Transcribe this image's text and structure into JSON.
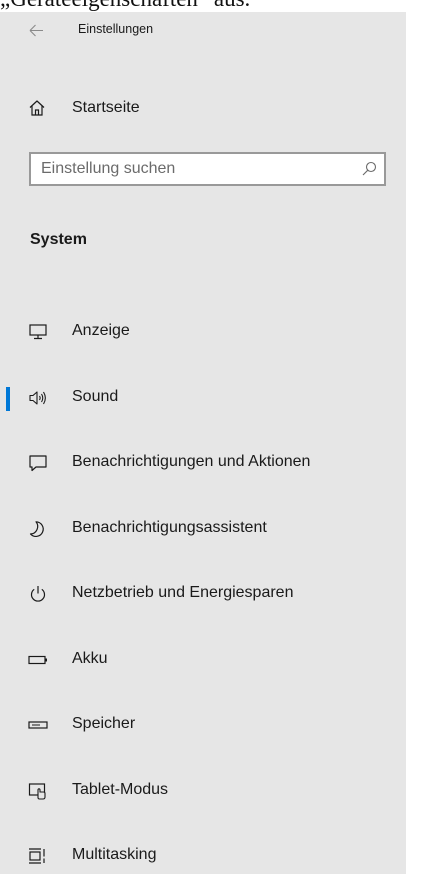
{
  "caption": {
    "partial_text": "„Geräteeigenschaften“ aus."
  },
  "window": {
    "title": "Einstellungen",
    "back_icon": "back-arrow-icon"
  },
  "home": {
    "label": "Startseite",
    "icon": "home-icon"
  },
  "search": {
    "placeholder": "Einstellung suchen",
    "value": "",
    "icon": "search-icon"
  },
  "section": {
    "title": "System"
  },
  "nav": {
    "items": [
      {
        "label": "Anzeige",
        "icon": "display-icon",
        "selected": false
      },
      {
        "label": "Sound",
        "icon": "speaker-icon",
        "selected": true
      },
      {
        "label": "Benachrichtigungen und Aktionen",
        "icon": "notification-icon",
        "selected": false
      },
      {
        "label": "Benachrichtigungsassistent",
        "icon": "moon-icon",
        "selected": false
      },
      {
        "label": "Netzbetrieb und Energiesparen",
        "icon": "power-icon",
        "selected": false
      },
      {
        "label": "Akku",
        "icon": "battery-icon",
        "selected": false
      },
      {
        "label": "Speicher",
        "icon": "storage-icon",
        "selected": false
      },
      {
        "label": "Tablet-Modus",
        "icon": "tablet-mode-icon",
        "selected": false
      },
      {
        "label": "Multitasking",
        "icon": "multitasking-icon",
        "selected": false
      }
    ]
  },
  "colors": {
    "panel_background": "#e6e6e6",
    "accent": "#0078d7",
    "search_border": "#999999",
    "text": "#1a1a1a"
  }
}
